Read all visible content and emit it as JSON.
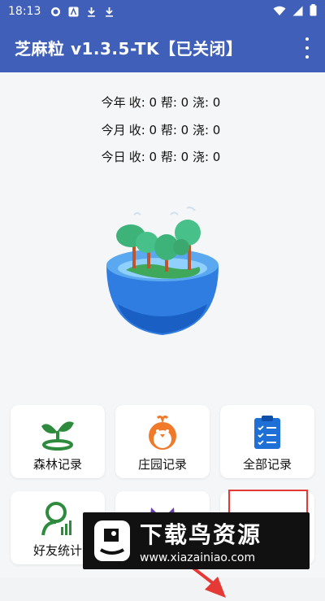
{
  "status_bar": {
    "time": "18:13"
  },
  "app_bar": {
    "title": "芝麻粒 v1.3.5-TK【已关闭】"
  },
  "stats": [
    {
      "period": "今年",
      "text": "收: 0 帮: 0 浇: 0"
    },
    {
      "period": "今月",
      "text": "收: 0 帮: 0 浇: 0"
    },
    {
      "period": "今日",
      "text": "收: 0 帮: 0 浇: 0"
    }
  ],
  "cards": [
    {
      "label": "森林记录",
      "icon": "sprout-icon"
    },
    {
      "label": "庄园记录",
      "icon": "chick-icon"
    },
    {
      "label": "全部记录",
      "icon": "clipboard-list-icon"
    },
    {
      "label": "好友统计",
      "icon": "user-chart-icon"
    },
    {
      "label": "",
      "icon": "cat-icon"
    },
    {
      "label": "",
      "icon": "settings-slider-icon"
    }
  ],
  "watermark": {
    "main": "下载鸟资源",
    "url": "www.xiazainiao.com"
  },
  "colors": {
    "app_bar": "#3f5fb8",
    "accent_green": "#2e8b3e",
    "accent_orange": "#f07a2a",
    "accent_blue": "#1e6fd6",
    "highlight_red": "#e53935"
  }
}
